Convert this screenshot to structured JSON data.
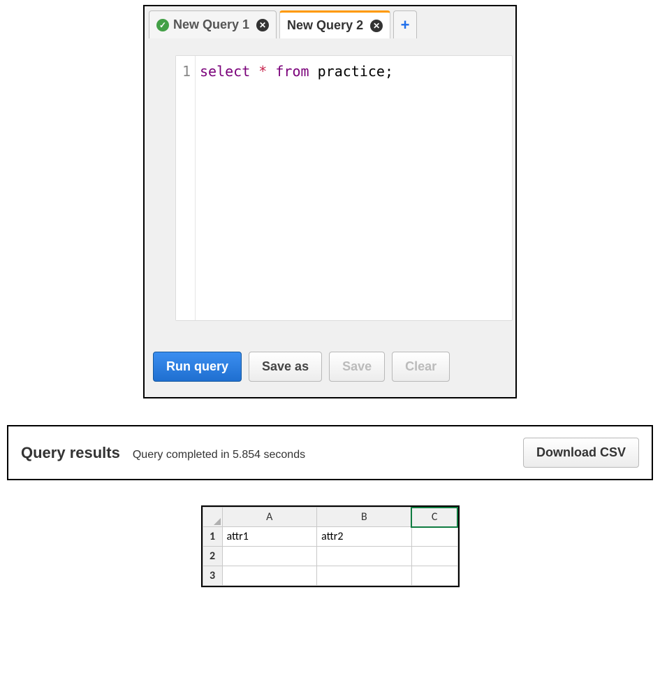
{
  "tabs": [
    {
      "label": "New Query 1",
      "status_icon": "check-icon",
      "active": false
    },
    {
      "label": "New Query 2",
      "status_icon": null,
      "active": true
    }
  ],
  "add_tab_glyph": "+",
  "editor": {
    "line_number": "1",
    "kw_select": "select",
    "star": "*",
    "kw_from": "from",
    "ident": "practice",
    "semicolon": ";"
  },
  "buttons": {
    "run": "Run query",
    "save_as": "Save as",
    "save": "Save",
    "clear": "Clear"
  },
  "results": {
    "title": "Query results",
    "status": "Query completed in 5.854 seconds",
    "download": "Download CSV"
  },
  "sheet": {
    "columns": [
      "A",
      "B",
      "C"
    ],
    "rows": [
      "1",
      "2",
      "3"
    ],
    "selected_col": "C",
    "cells": {
      "A1": "attr1",
      "B1": "attr2"
    }
  }
}
